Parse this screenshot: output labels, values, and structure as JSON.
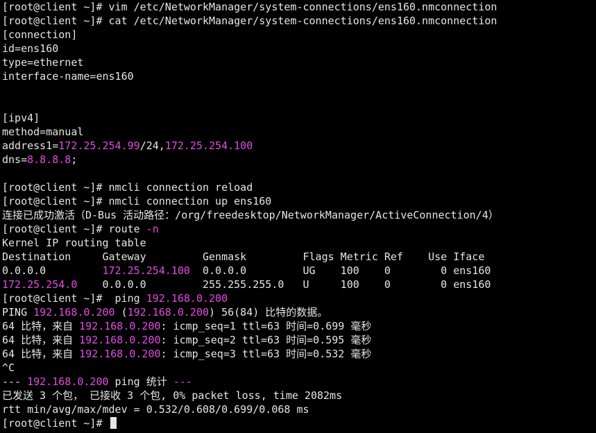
{
  "terminal": {
    "lines": [
      [
        {
          "t": "[root@client ~]# vim /etc/NetworkManager/system-connections/ens160.nmconnection"
        }
      ],
      [
        {
          "t": "[root@client ~]# cat /etc/NetworkManager/system-connections/ens160.nmconnection"
        }
      ],
      [
        {
          "t": "[connection]"
        }
      ],
      [
        {
          "t": "id=ens160"
        }
      ],
      [
        {
          "t": "type=ethernet"
        }
      ],
      [
        {
          "t": "interface-name=ens160"
        }
      ],
      [
        {
          "t": ""
        }
      ],
      [
        {
          "t": ""
        }
      ],
      [
        {
          "t": "[ipv4]"
        }
      ],
      [
        {
          "t": "method=manual"
        }
      ],
      [
        {
          "t": "address1="
        },
        {
          "t": "172.25.254.99",
          "c": "magenta"
        },
        {
          "t": "/24,"
        },
        {
          "t": "172.25.254.100",
          "c": "magenta"
        }
      ],
      [
        {
          "t": "dns="
        },
        {
          "t": "8.8.8.8",
          "c": "magenta"
        },
        {
          "t": ";"
        }
      ],
      [
        {
          "t": ""
        }
      ],
      [
        {
          "t": "[root@client ~]# nmcli connection reload"
        }
      ],
      [
        {
          "t": "[root@client ~]# nmcli connection up ens160"
        }
      ],
      [
        {
          "t": "连接已成功激活（D-Bus 活动路径：/org/freedesktop/NetworkManager/ActiveConnection/4）"
        }
      ],
      [
        {
          "t": "[root@client ~]# route "
        },
        {
          "t": "-n",
          "c": "magenta"
        }
      ],
      [
        {
          "t": "Kernel IP routing table"
        }
      ],
      [
        {
          "t": "Destination     Gateway         Genmask         Flags Metric Ref    Use Iface"
        }
      ],
      [
        {
          "t": "0.0.0.0         "
        },
        {
          "t": "172.25.254.100",
          "c": "magenta"
        },
        {
          "t": "  0.0.0.0         UG    100    0        0 ens160"
        }
      ],
      [
        {
          "t": "172.25.254.0",
          "c": "magenta"
        },
        {
          "t": "    0.0.0.0         255.255.255.0   U     100    0        0 ens160"
        }
      ],
      [
        {
          "t": "[root@client ~]#  ping "
        },
        {
          "t": "192.168.0.200",
          "c": "magenta"
        }
      ],
      [
        {
          "t": "PING "
        },
        {
          "t": "192.168.0.200",
          "c": "magenta"
        },
        {
          "t": " ("
        },
        {
          "t": "192.168.0.200",
          "c": "magenta"
        },
        {
          "t": ") 56(84) 比特的数据。"
        }
      ],
      [
        {
          "t": "64 比特，来自 "
        },
        {
          "t": "192.168.0.200",
          "c": "magenta"
        },
        {
          "t": ": icmp_seq=1 ttl=63 时间=0.699 毫秒"
        }
      ],
      [
        {
          "t": "64 比特，来自 "
        },
        {
          "t": "192.168.0.200",
          "c": "magenta"
        },
        {
          "t": ": icmp_seq=2 ttl=63 时间=0.595 毫秒"
        }
      ],
      [
        {
          "t": "64 比特，来自 "
        },
        {
          "t": "192.168.0.200",
          "c": "magenta"
        },
        {
          "t": ": icmp_seq=3 ttl=63 时间=0.532 毫秒"
        }
      ],
      [
        {
          "t": "^C"
        }
      ],
      [
        {
          "t": "--- "
        },
        {
          "t": "192.168.0.200",
          "c": "magenta"
        },
        {
          "t": " ping 统计 "
        },
        {
          "t": "---",
          "c": "magenta"
        }
      ],
      [
        {
          "t": "已发送 3 个包， 已接收 3 个包, 0% packet loss, time 2082ms"
        }
      ],
      [
        {
          "t": "rtt min/avg/max/mdev = 0.532/0.608/0.699/0.068 ms"
        }
      ],
      [
        {
          "t": "[root@client ~]# "
        }
      ]
    ]
  },
  "colors": {
    "background": "#000000",
    "foreground": "#e6e6e6",
    "highlight": "#e34ce3"
  }
}
